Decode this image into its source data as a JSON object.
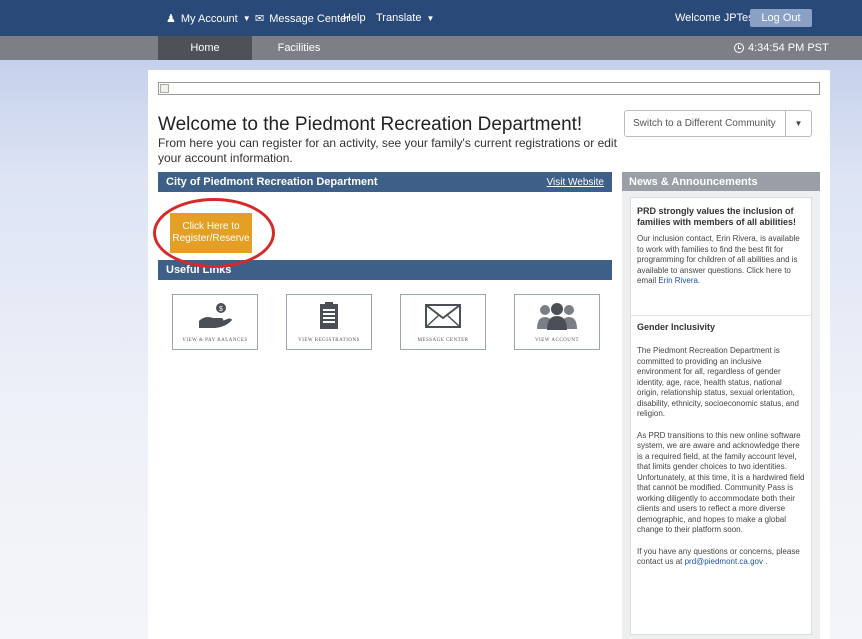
{
  "topbar": {
    "my_account": "My Account",
    "message_center": "Message Center",
    "help": "Help",
    "translate": "Translate",
    "welcome": "Welcome JPTest",
    "logout": "Log Out"
  },
  "subnav": {
    "tabs": [
      {
        "label": "Home",
        "active": true
      },
      {
        "label": "Facilities",
        "active": false
      }
    ],
    "time": "4:34:54 PM PST"
  },
  "main": {
    "title": "Welcome to the Piedmont Recreation Department!",
    "subtitle": "From here you can register for an activity, see your family's current registrations or edit your account information.",
    "community_select": "Switch to a Different Community",
    "dept_section": {
      "title": "City of Piedmont Recreation Department",
      "visit_link": "Visit Website"
    },
    "register_button": "Click Here to Register/Reserve",
    "useful_links": {
      "title": "Useful Links",
      "items": [
        {
          "label": "VIEW & PAY BALANCES",
          "icon": "hand-coin-icon"
        },
        {
          "label": "VIEW REGISTRATIONS",
          "icon": "clipboard-icon"
        },
        {
          "label": "MESSAGE CENTER",
          "icon": "envelope-icon"
        },
        {
          "label": "VIEW ACCOUNT",
          "icon": "people-icon"
        }
      ]
    }
  },
  "news": {
    "title": "News & Announcements",
    "items": [
      {
        "title": "PRD strongly values the inclusion of families with members of all abilities!",
        "paragraphs": [
          "Our inclusion contact, Erin Rivera, is available to work with families to find the best fit for programming for children of all abilities and is available to answer questions. Click here to email"
        ],
        "link": "Erin Rivera."
      },
      {
        "title": "Gender Inclusivity",
        "paragraphs": [
          "The Piedmont Recreation Department is committed to providing an inclusive environment for all, regardless of gender identity, age, race, health status, national origin, relationship status, sexual orientation, disability, ethnicity, socioeconomic status, and religion.",
          "As PRD transitions to this new online software system, we are aware and acknowledge there is a required field, at the family account level, that limits gender choices to two identities. Unfortunately, at this time, it is a hardwired field that cannot be modified. Community Pass is working diligently to accommodate both their clients and users to reflect a more diverse demographic, and hopes to make a global change to their platform soon.",
          "If you have any questions or concerns, please contact us at"
        ],
        "link": "prd@piedmont.ca.gov ."
      }
    ]
  },
  "colors": {
    "topbar": "#294a78",
    "subnav": "#7c7f86",
    "section_header": "#3d5f88",
    "register_button": "#e3a024",
    "highlight_circle": "#d42a2a"
  }
}
